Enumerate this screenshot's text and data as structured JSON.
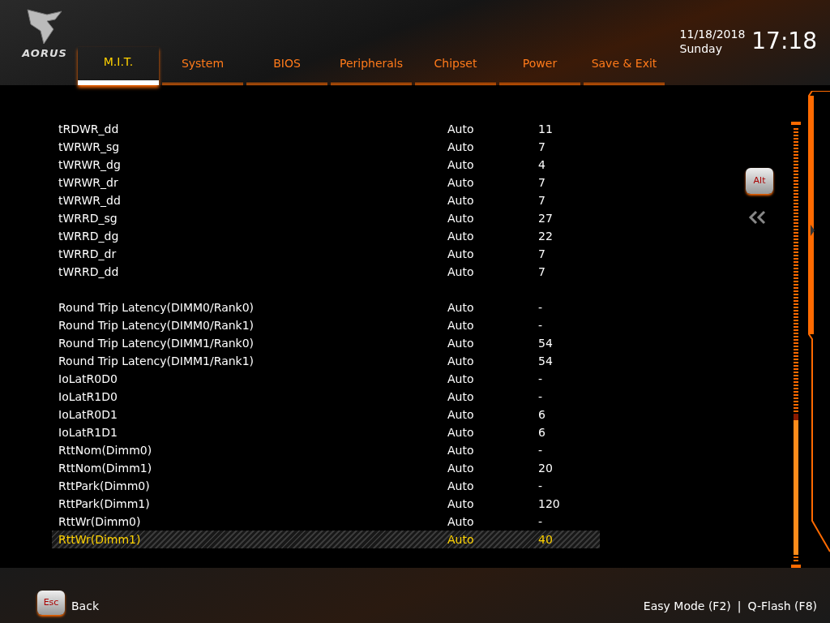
{
  "brand": {
    "name": "AORUS"
  },
  "tabs": [
    {
      "label": "M.I.T.",
      "selected": true
    },
    {
      "label": "System",
      "selected": false
    },
    {
      "label": "BIOS",
      "selected": false
    },
    {
      "label": "Peripherals",
      "selected": false
    },
    {
      "label": "Chipset",
      "selected": false
    },
    {
      "label": "Power",
      "selected": false
    },
    {
      "label": "Save & Exit",
      "selected": false
    }
  ],
  "clock": {
    "date": "11/18/2018",
    "day": "Sunday",
    "time": "17:18"
  },
  "settings_groups": [
    [
      {
        "label": "tRDWR_dd",
        "mode": "Auto",
        "value": "11",
        "selected": false
      },
      {
        "label": "tWRWR_sg",
        "mode": "Auto",
        "value": "7",
        "selected": false
      },
      {
        "label": "tWRWR_dg",
        "mode": "Auto",
        "value": "4",
        "selected": false
      },
      {
        "label": "tWRWR_dr",
        "mode": "Auto",
        "value": "7",
        "selected": false
      },
      {
        "label": "tWRWR_dd",
        "mode": "Auto",
        "value": "7",
        "selected": false
      },
      {
        "label": "tWRRD_sg",
        "mode": "Auto",
        "value": "27",
        "selected": false
      },
      {
        "label": "tWRRD_dg",
        "mode": "Auto",
        "value": "22",
        "selected": false
      },
      {
        "label": "tWRRD_dr",
        "mode": "Auto",
        "value": "7",
        "selected": false
      },
      {
        "label": "tWRRD_dd",
        "mode": "Auto",
        "value": "7",
        "selected": false
      }
    ],
    [
      {
        "label": "Round Trip Latency(DIMM0/Rank0)",
        "mode": "Auto",
        "value": "-",
        "selected": false
      },
      {
        "label": "Round Trip Latency(DIMM0/Rank1)",
        "mode": "Auto",
        "value": "-",
        "selected": false
      },
      {
        "label": "Round Trip Latency(DIMM1/Rank0)",
        "mode": "Auto",
        "value": "54",
        "selected": false
      },
      {
        "label": "Round Trip Latency(DIMM1/Rank1)",
        "mode": "Auto",
        "value": "54",
        "selected": false
      },
      {
        "label": "IoLatR0D0",
        "mode": "Auto",
        "value": "-",
        "selected": false
      },
      {
        "label": "IoLatR1D0",
        "mode": "Auto",
        "value": "-",
        "selected": false
      },
      {
        "label": "IoLatR0D1",
        "mode": "Auto",
        "value": "6",
        "selected": false
      },
      {
        "label": "IoLatR1D1",
        "mode": "Auto",
        "value": "6",
        "selected": false
      },
      {
        "label": "RttNom(Dimm0)",
        "mode": "Auto",
        "value": "-",
        "selected": false
      },
      {
        "label": "RttNom(Dimm1)",
        "mode": "Auto",
        "value": "20",
        "selected": false
      },
      {
        "label": "RttPark(Dimm0)",
        "mode": "Auto",
        "value": "-",
        "selected": false
      },
      {
        "label": "RttPark(Dimm1)",
        "mode": "Auto",
        "value": "120",
        "selected": false
      },
      {
        "label": "RttWr(Dimm0)",
        "mode": "Auto",
        "value": "-",
        "selected": false
      },
      {
        "label": "RttWr(Dimm1)",
        "mode": "Auto",
        "value": "40",
        "selected": true
      }
    ]
  ],
  "side_keys": {
    "alt": "Alt"
  },
  "footer": {
    "esc_key": "Esc",
    "back": "Back",
    "easy_mode": "Easy Mode (F2)",
    "separator": "|",
    "qflash": "Q-Flash (F8)"
  }
}
